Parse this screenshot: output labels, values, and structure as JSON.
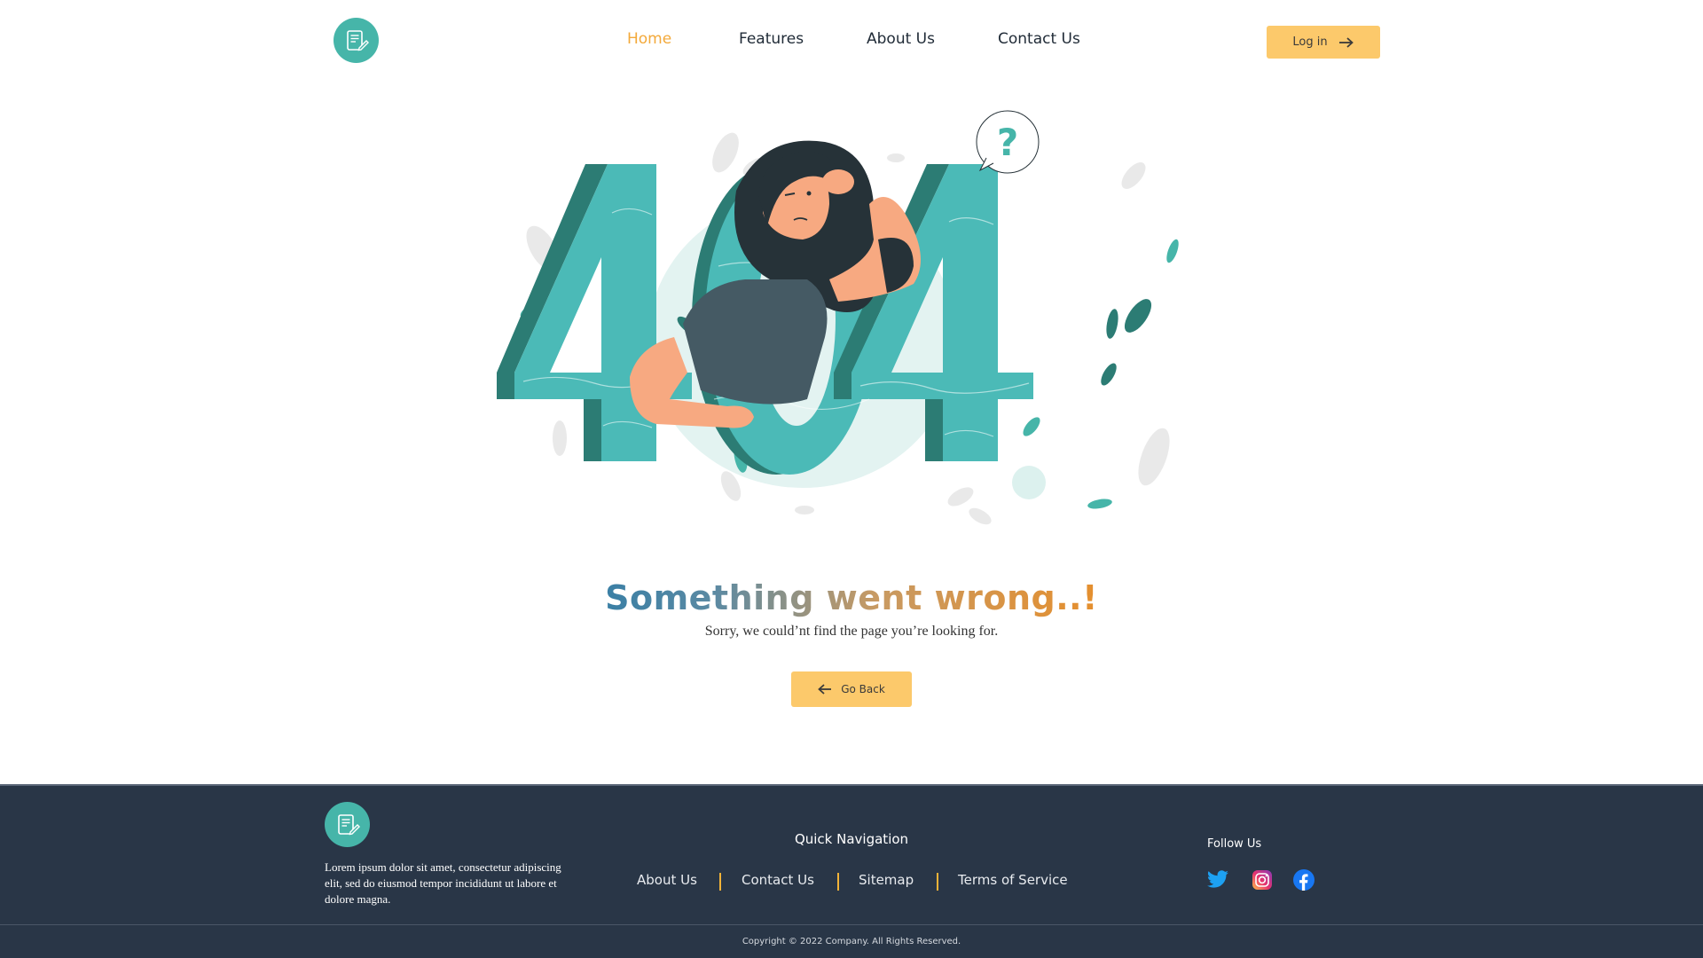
{
  "header": {
    "nav": [
      {
        "label": "Home",
        "active": true
      },
      {
        "label": "Features",
        "active": false
      },
      {
        "label": "About Us",
        "active": false
      },
      {
        "label": "Contact Us",
        "active": false
      }
    ],
    "login_label": "Log in"
  },
  "illustration": {
    "digits": "404",
    "question_mark": "?"
  },
  "message": {
    "headline": "Something went wrong..!",
    "subtext": "Sorry, we could’nt find the page you’re looking for.",
    "goback_label": "Go Back"
  },
  "footer": {
    "description": "Lorem ipsum dolor sit amet, consectetur adipiscing elit, sed do eiusmod tempor incididunt ut labore et dolore magna.",
    "quick_nav_title": "Quick Navigation",
    "quick_nav_links": [
      "About Us",
      "Contact Us",
      "Sitemap",
      "Terms of Service"
    ],
    "follow_title": "Follow Us",
    "social": [
      "twitter-icon",
      "instagram-icon",
      "facebook-icon"
    ],
    "copyright": "Copyright © 2022 Company. All Rights Reserved."
  },
  "colors": {
    "accent": "#f3a93a",
    "button": "#fcc96b",
    "teal": "#46b5a9",
    "footer_bg": "#293647"
  }
}
